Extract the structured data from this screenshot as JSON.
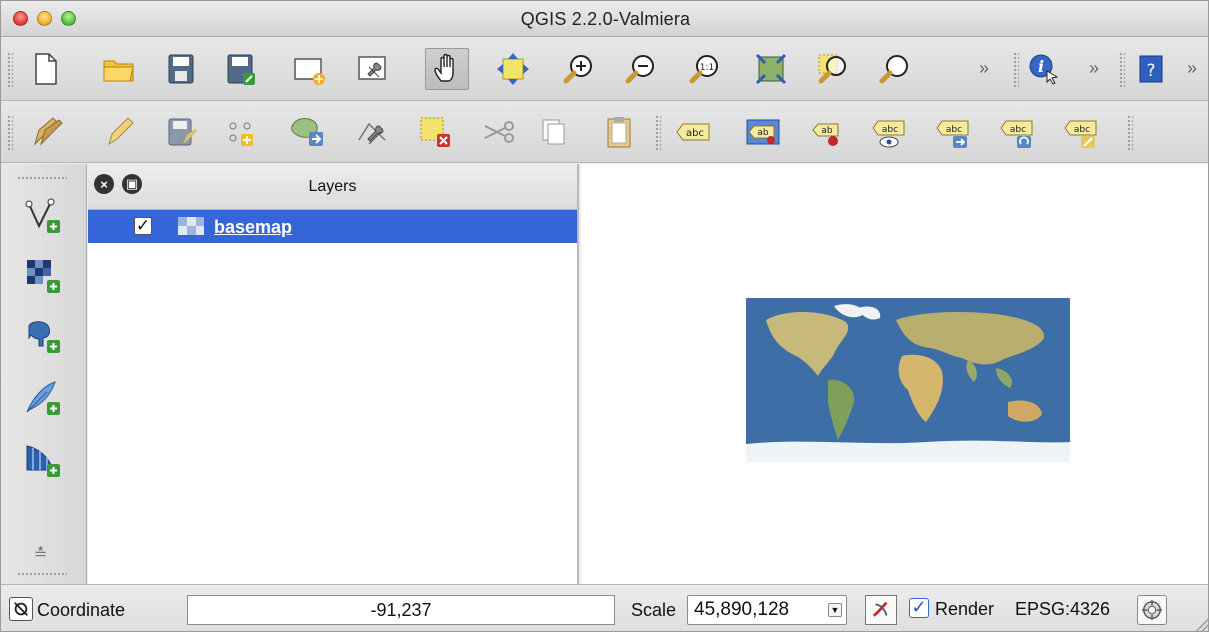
{
  "window": {
    "title": "QGIS 2.2.0-Valmiera"
  },
  "toolbar_main": {
    "tools": [
      "new-project",
      "open-project",
      "save-project",
      "save-as",
      "new-print-composer",
      "composer-manager",
      "pan",
      "pan-to-selection",
      "zoom-in",
      "zoom-out",
      "zoom-native",
      "zoom-full",
      "zoom-to-selection",
      "zoom-to-layer",
      "identify",
      "help"
    ],
    "overflow": "»"
  },
  "toolbar_digitize": {
    "tools": [
      "current-edits",
      "toggle-editing",
      "save-edits",
      "add-feature",
      "move-feature",
      "node-tool",
      "delete-selected",
      "cut-features",
      "copy-features",
      "paste-features",
      "label-layer",
      "pin-labels",
      "highlight-pinned",
      "show-hide-labels",
      "move-label",
      "rotate-label",
      "change-label"
    ],
    "label_text": "abc",
    "label_text_short": "ab"
  },
  "layer_toolbar": {
    "more": "»"
  },
  "layers_panel": {
    "title": "Layers",
    "layers": [
      {
        "name": "basemap",
        "checked": true,
        "selected": true
      }
    ]
  },
  "statusbar": {
    "coordinate_label": "Coordinate",
    "coordinate_value": "-91,237",
    "scale_label": "Scale",
    "scale_value": "45,890,128",
    "render_label": "Render",
    "render_checked": true,
    "crs": "EPSG:4326"
  },
  "colors": {
    "selection": "#3665d9",
    "ocean": "#3b6fa8",
    "land": "#c9b77a"
  }
}
